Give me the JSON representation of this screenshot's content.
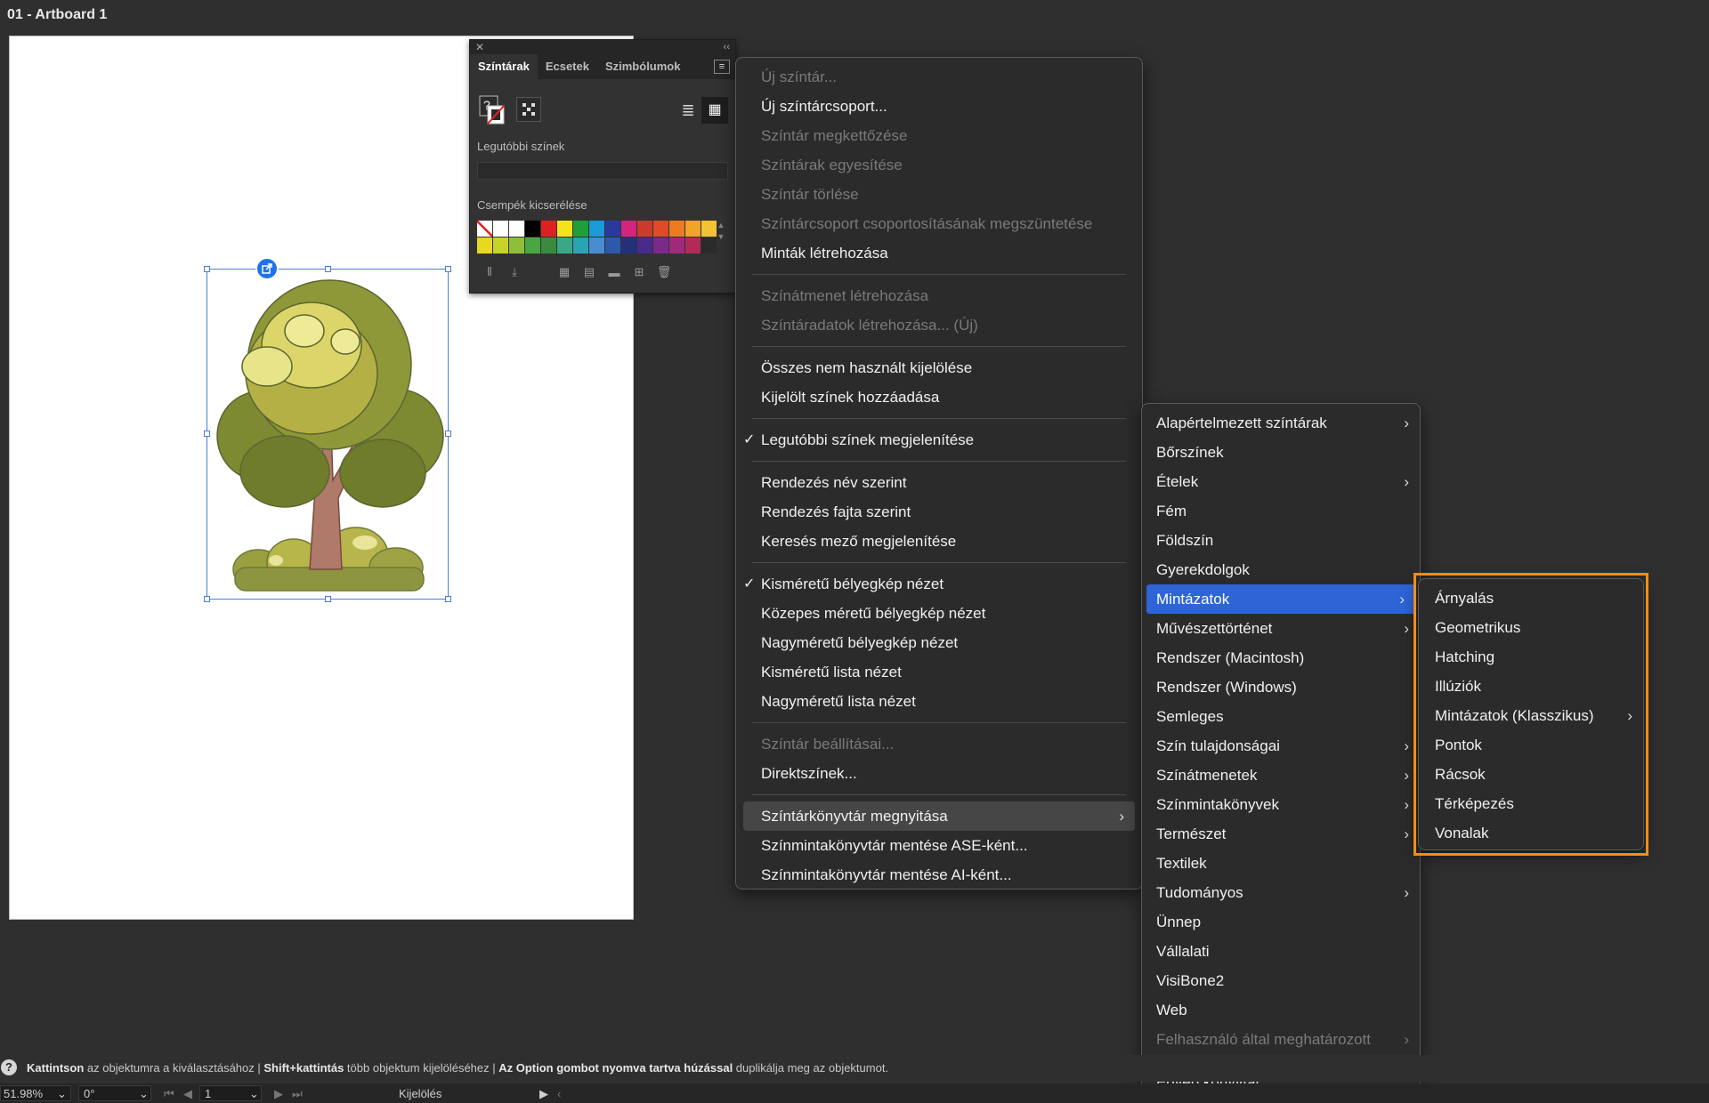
{
  "document": {
    "title": "01 - Artboard 1"
  },
  "swatches_panel": {
    "tabs": [
      "Színtárak",
      "Ecsetek",
      "Szimbólumok"
    ],
    "fill_stroke_label": "?",
    "recent_label": "Legutóbbi színek",
    "group_label": "Csempék kicserélése",
    "colors": {
      "row1": [
        "none",
        "#ffffff",
        "#ffffff",
        "#000000",
        "#e02020",
        "#f5e21a",
        "#1f9e3a",
        "#1a9ad6",
        "#2a3a9a",
        "#d4247e",
        "#cc3a2e",
        "#e04a28",
        "#ee7a22",
        "#f2a32a",
        "#f4c232"
      ],
      "row2": [
        "#e8d820",
        "#c8d22a",
        "#8fbf3a",
        "#4aa640",
        "#3a8a3e",
        "#3aa886",
        "#2aa4b4",
        "#4a8cd0",
        "#2a5aa8",
        "#23307a",
        "#4a2a8a",
        "#7a2a8a",
        "#a02a7a",
        "#b22a5a",
        "#2b2b2b"
      ]
    },
    "icons": [
      "library-icon",
      "place-icon",
      "swatch-kind-icon",
      "swatch-options-icon",
      "folder-icon",
      "new-swatch-icon",
      "delete-icon"
    ]
  },
  "main_menu": {
    "items": [
      {
        "label": "Új színtár...",
        "disabled": true
      },
      {
        "label": "Új színtárcsoport...",
        "disabled": false
      },
      {
        "label": "Színtár megkettőzése",
        "disabled": true
      },
      {
        "label": "Színtárak egyesítése",
        "disabled": true
      },
      {
        "label": "Színtár törlése",
        "disabled": true
      },
      {
        "label": "Színtárcsoport csoportosításának megszüntetése",
        "disabled": true
      },
      {
        "label": "Minták létrehozása",
        "disabled": false
      },
      {
        "label": "Színátmenet létrehozása",
        "disabled": true
      },
      {
        "label": "Színtáradatok létrehozása... (Új)",
        "disabled": true
      },
      {
        "label": "Összes nem használt kijelölése",
        "disabled": false
      },
      {
        "label": "Kijelölt színek hozzáadása",
        "disabled": false
      },
      {
        "label": "Legutóbbi színek megjelenítése",
        "disabled": false,
        "checked": true
      },
      {
        "label": "Rendezés név szerint",
        "disabled": false
      },
      {
        "label": "Rendezés fajta szerint",
        "disabled": false
      },
      {
        "label": "Keresés mező megjelenítése",
        "disabled": false
      },
      {
        "label": "Kisméretű bélyegkép nézet",
        "disabled": false,
        "checked": true
      },
      {
        "label": "Közepes méretű bélyegkép nézet",
        "disabled": false
      },
      {
        "label": "Nagyméretű bélyegkép nézet",
        "disabled": false
      },
      {
        "label": "Kisméretű lista nézet",
        "disabled": false
      },
      {
        "label": "Nagyméretű lista nézet",
        "disabled": false
      },
      {
        "label": "Színtár beállításai...",
        "disabled": true
      },
      {
        "label": "Direktszínek...",
        "disabled": false
      },
      {
        "label": "Színtárkönyvtár megnyitása",
        "disabled": false,
        "submenu": true,
        "highlighted": true
      },
      {
        "label": "Színmintakönyvtár mentése ASE-ként...",
        "disabled": false
      },
      {
        "label": "Színmintakönyvtár mentése AI-ként...",
        "disabled": false
      }
    ],
    "checkmark": "✓",
    "arrow": "›"
  },
  "library_menu": {
    "items": [
      {
        "label": "Alapértelmezett színtárak",
        "submenu": true
      },
      {
        "label": "Bőrszínek"
      },
      {
        "label": "Ételek",
        "submenu": true
      },
      {
        "label": "Fém"
      },
      {
        "label": "Földszín"
      },
      {
        "label": "Gyerekdolgok"
      },
      {
        "label": "Mintázatok",
        "submenu": true,
        "highlighted": true
      },
      {
        "label": "Művészettörténet",
        "submenu": true
      },
      {
        "label": "Rendszer (Macintosh)"
      },
      {
        "label": "Rendszer (Windows)"
      },
      {
        "label": "Semleges"
      },
      {
        "label": "Szín tulajdonságai",
        "submenu": true
      },
      {
        "label": "Színátmenetek",
        "submenu": true
      },
      {
        "label": "Színmintakönyvek",
        "submenu": true
      },
      {
        "label": "Természet",
        "submenu": true
      },
      {
        "label": "Textilek"
      },
      {
        "label": "Tudományos",
        "submenu": true
      },
      {
        "label": "Ünnep"
      },
      {
        "label": "Vállalati"
      },
      {
        "label": "VisiBone2"
      },
      {
        "label": "Web"
      },
      {
        "label": "Felhasználó által meghatározott",
        "submenu": true,
        "disabled": true
      },
      {
        "label": "Egyéb könyvtár..."
      }
    ]
  },
  "patterns_menu": {
    "items": [
      {
        "label": "Árnyalás"
      },
      {
        "label": "Geometrikus"
      },
      {
        "label": "Hatching"
      },
      {
        "label": "Illúziók"
      },
      {
        "label": "Mintázatok (Klasszikus)",
        "submenu": true
      },
      {
        "label": "Pontok"
      },
      {
        "label": "Rácsok"
      },
      {
        "label": "Térképezés"
      },
      {
        "label": "Vonalak"
      }
    ],
    "highlight_color": "#f08e18"
  },
  "status": {
    "help": "?",
    "part1_bold": "Kattintson",
    "part1": " az objektumra a kiválasztásához",
    "sep": "  |  ",
    "part2_bold": "Shift+kattintás",
    "part2": " több objektum kijelöléséhez",
    "part3_bold": "Az Option gombot nyomva tartva húzással",
    "part3": " duplikálja meg az objektumot."
  },
  "bottom_bar": {
    "zoom": "51.98%",
    "rotation": "0°",
    "artboard_number": "1",
    "tool_name": "Kijelölés"
  }
}
